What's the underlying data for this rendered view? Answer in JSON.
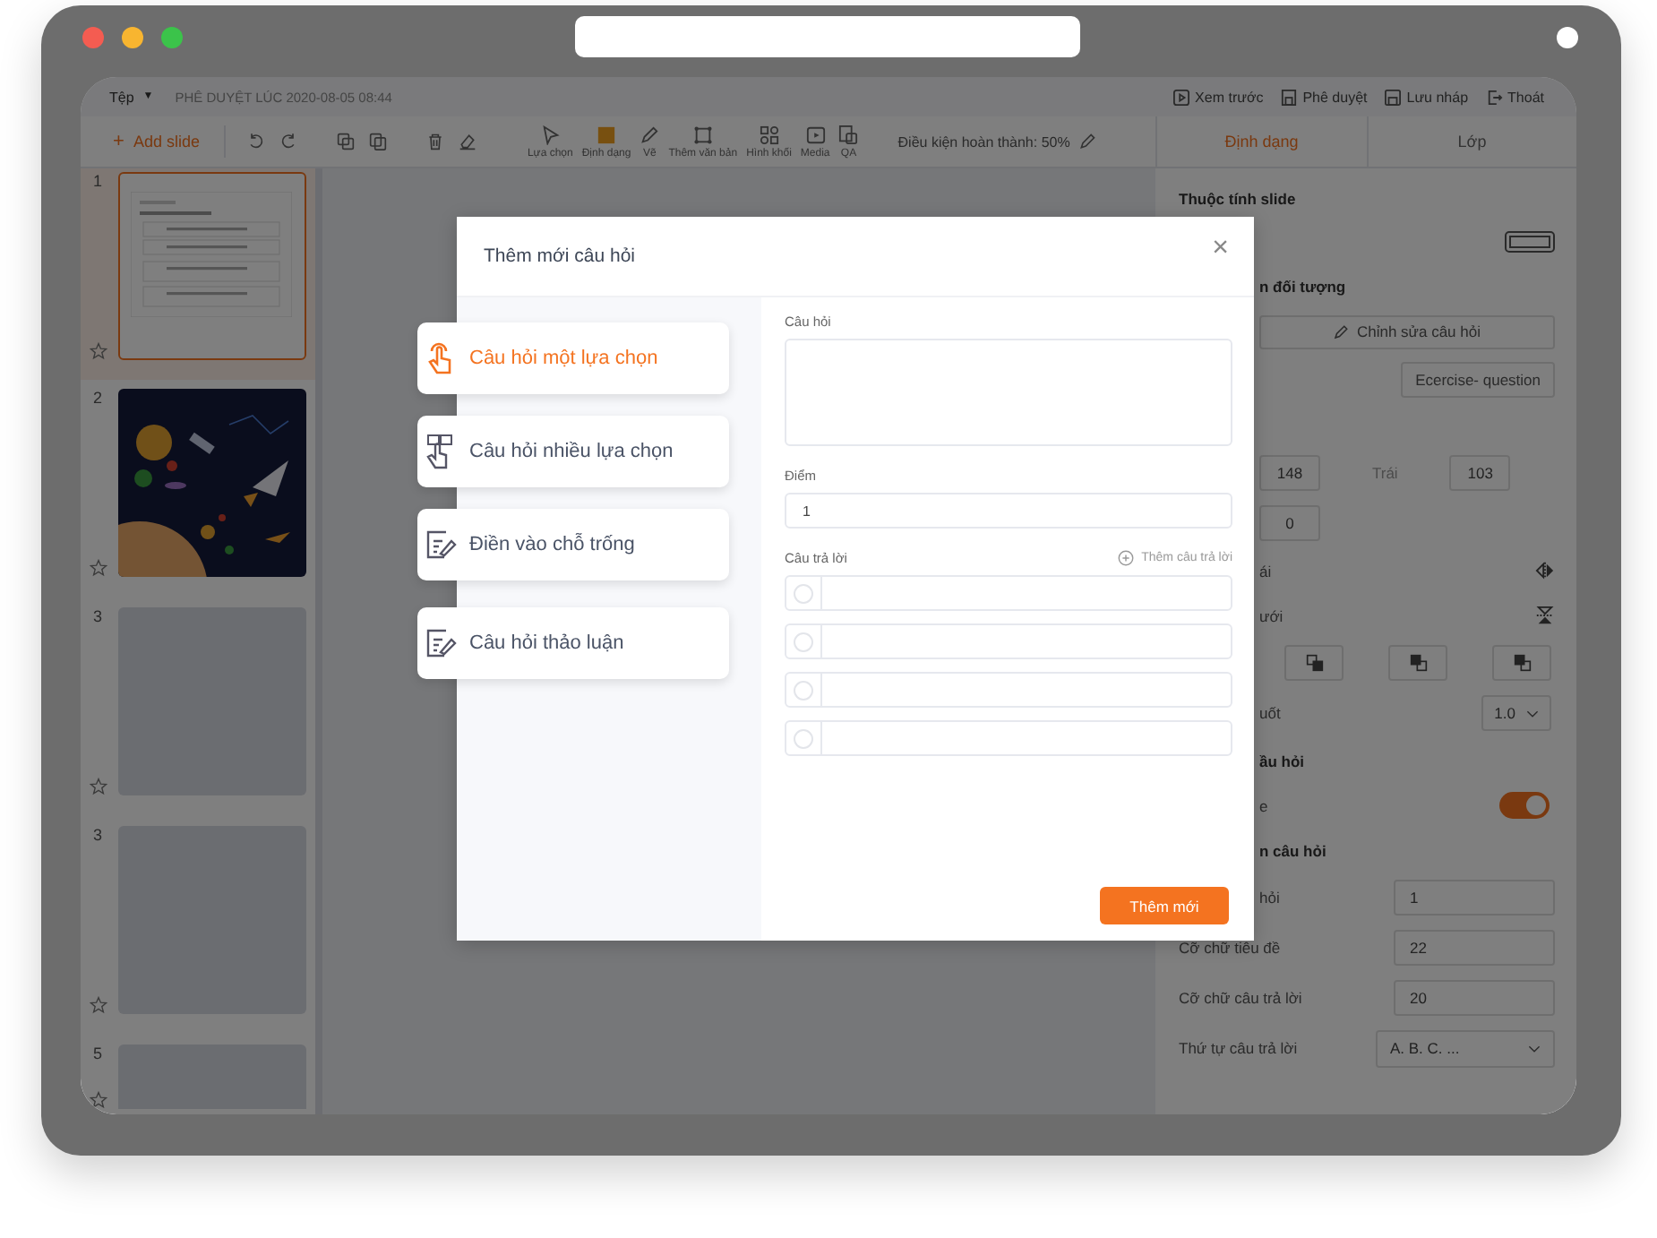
{
  "top_bar": {
    "file_menu": "Tệp",
    "file_caret": "▼",
    "approved_at": "PHÊ DUYỆT LÚC 2020-08-05  08:44",
    "actions": [
      {
        "kind": "preview",
        "label": "Xem trước"
      },
      {
        "kind": "approve",
        "label": "Phê duyệt"
      },
      {
        "kind": "save",
        "label": "Lưu nháp"
      },
      {
        "kind": "exit",
        "label": "Thoát"
      }
    ]
  },
  "toolbar": {
    "add_slide": {
      "icon": "+",
      "label": "Add slide"
    },
    "tools": [
      {
        "kind": "select",
        "label": "Lựa chọn"
      },
      {
        "kind": "format",
        "label": "Định dạng"
      },
      {
        "kind": "draw",
        "label": "Vẽ"
      },
      {
        "kind": "text",
        "label": "Thêm văn bản"
      },
      {
        "kind": "shapes",
        "label": "Hình khối"
      },
      {
        "kind": "media",
        "label": "Media"
      },
      {
        "kind": "qa",
        "label": "QA"
      }
    ],
    "completion": "Điều kiện hoàn thành: 50%",
    "panel_tabs": [
      {
        "label": "Định dạng",
        "selected": true
      },
      {
        "label": "Lớp",
        "selected": false
      }
    ]
  },
  "slides": [
    {
      "number": "1",
      "selected": true,
      "kind": "question"
    },
    {
      "number": "2",
      "selected": false,
      "kind": "picture"
    },
    {
      "number": "3",
      "selected": false,
      "kind": "blank"
    },
    {
      "number": "3",
      "selected": false,
      "kind": "blank"
    },
    {
      "number": "5",
      "selected": false,
      "kind": "blank"
    }
  ],
  "properties": [
    {
      "kind": "heading",
      "label": "Thuộc tính slide"
    },
    {
      "kind": "size-icon"
    },
    {
      "kind": "heading",
      "label": "n đối tượng",
      "covered": true
    },
    {
      "kind": "wide-button",
      "label": "Chỉnh sửa câu hỏi"
    },
    {
      "kind": "small-button",
      "label": "Ecercise- question"
    },
    {
      "kind": "numbers",
      "value": "148",
      "label": "Trái",
      "value_2": "103"
    },
    {
      "kind": "numbers",
      "value": "0"
    },
    {
      "kind": "flip-horizontal",
      "label": "ái",
      "covered": true
    },
    {
      "kind": "flip-vertical",
      "label": "ưới",
      "covered": true
    },
    {
      "kind": "arrange"
    },
    {
      "kind": "select",
      "label": "uốt",
      "value": "1.0",
      "covered": true
    },
    {
      "kind": "heading",
      "label": "ầu hỏi",
      "covered": true
    },
    {
      "kind": "toggle",
      "label": "e",
      "on": true,
      "covered": true
    },
    {
      "kind": "heading",
      "label": "n câu hỏi",
      "covered": true
    },
    {
      "kind": "field",
      "label": "hỏi",
      "value": "1",
      "covered": true
    },
    {
      "kind": "field",
      "label": "Cỡ chữ tiêu đề",
      "value": "22"
    },
    {
      "kind": "field",
      "label": "Cỡ chữ câu trả lời",
      "value": "20"
    },
    {
      "kind": "select-wide",
      "label": "Thứ tự câu trả lời",
      "value": "A. B. C. ..."
    }
  ],
  "dialog": {
    "title": "Thêm mới câu hỏi",
    "close": "×",
    "question_types": [
      {
        "kind": "single",
        "label": "Câu hỏi một lựa chọn",
        "selected": true
      },
      {
        "kind": "multiple",
        "label": "Câu hỏi nhiều lựa chọn",
        "selected": false
      },
      {
        "kind": "fill",
        "label": "Điền vào chỗ trống",
        "selected": false
      },
      {
        "kind": "discussion",
        "label": "Câu hỏi thảo luận",
        "selected": false
      }
    ],
    "question_label": "Câu hỏi",
    "score_label": "Điểm",
    "score_value": "1",
    "answers_label": "Câu trả lời",
    "add_answer": "Thêm câu trả lời",
    "answers": [
      {
        "selected": false
      },
      {
        "selected": false
      },
      {
        "selected": false
      },
      {
        "selected": false
      }
    ],
    "submit": "Thêm mới"
  }
}
